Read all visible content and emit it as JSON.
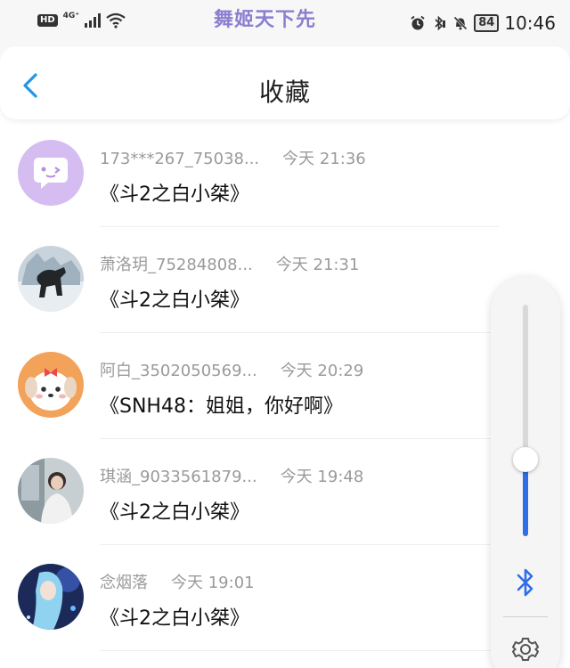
{
  "status_bar": {
    "hd_label": "HD",
    "network_label": "4G⁺",
    "watermark": "舞姬天下先",
    "battery": "84",
    "time": "10:46"
  },
  "header": {
    "title": "收藏"
  },
  "favorites": [
    {
      "name": "173***267_75038...",
      "time": "今天 21:36",
      "content": "《斗2之白小桀》",
      "avatar": "chat-bubble-avatar"
    },
    {
      "name": "萧洛玥_75284808...",
      "time": "今天 21:31",
      "content": "《斗2之白小桀》",
      "avatar": "wolf-avatar"
    },
    {
      "name": "阿白_3502050569...",
      "time": "今天 20:29",
      "content": "《SNH48：姐姐，你好啊》",
      "avatar": "cartoon-dog-avatar"
    },
    {
      "name": "琪涵_9033561879...",
      "time": "今天 19:48",
      "content": "《斗2之白小桀》",
      "avatar": "girl-photo-avatar"
    },
    {
      "name": "念烟落",
      "time": "今天 19:01",
      "content": "《斗2之白小桀》",
      "avatar": "anime-avatar"
    }
  ],
  "volume_panel": {
    "level": 0.33,
    "accent_color": "#2f6ee6"
  }
}
